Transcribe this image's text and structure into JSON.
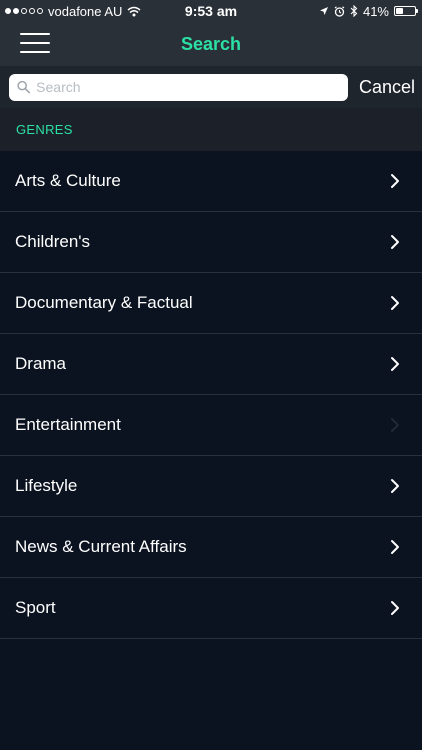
{
  "status_bar": {
    "carrier": "vodafone AU",
    "time": "9:53 am",
    "battery_percent": "41%",
    "battery_level": 0.41,
    "signal_dots_filled": 2,
    "signal_dots_total": 5
  },
  "nav": {
    "title": "Search",
    "menu_icon": "hamburger-menu-icon"
  },
  "search": {
    "placeholder": "Search",
    "value": "",
    "cancel_label": "Cancel"
  },
  "section": {
    "title": "GENRES"
  },
  "genres": [
    {
      "label": "Arts & Culture"
    },
    {
      "label": "Children's"
    },
    {
      "label": "Documentary & Factual"
    },
    {
      "label": "Drama"
    },
    {
      "label": "Entertainment"
    },
    {
      "label": "Lifestyle"
    },
    {
      "label": "News & Current Affairs"
    },
    {
      "label": "Sport"
    }
  ],
  "colors": {
    "accent": "#2ce0a4",
    "background": "#0b1220",
    "bar": "#2a3038"
  }
}
